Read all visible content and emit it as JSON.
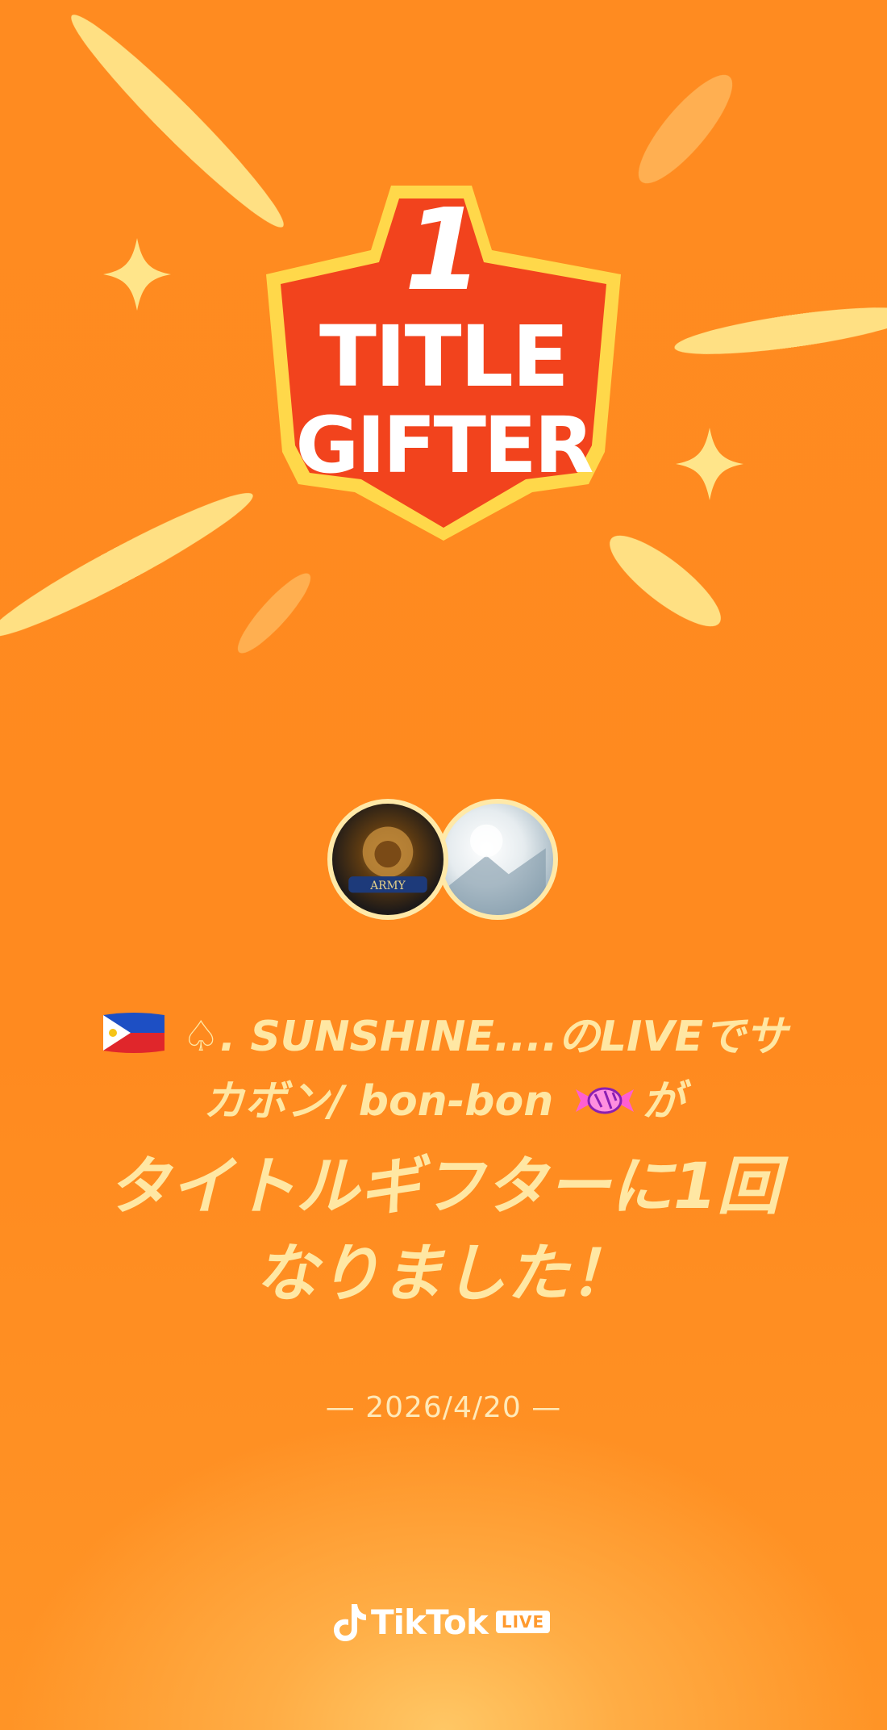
{
  "badge": {
    "number": "1",
    "line1": "TITLE",
    "line2": "GIFTER"
  },
  "avatars": [
    {
      "name": "army-lion-avatar",
      "caption": "ARMY"
    },
    {
      "name": "bonbon-avatar"
    }
  ],
  "message": {
    "part1": "♤. SUNSHINE....のLIVEでサ",
    "part2": "カボン/ bon-bon",
    "part3": "が",
    "headline_1": "タイトルギフターに1回",
    "headline_2": "なりました！"
  },
  "date": "— 2026/4/20 —",
  "brand": {
    "name": "TikTok",
    "tag": "LIVE"
  },
  "colors": {
    "background": "#ff8b20",
    "text": "#ffe7a3",
    "badge_red": "#f2431d",
    "badge_yellow": "#ffd84a"
  }
}
